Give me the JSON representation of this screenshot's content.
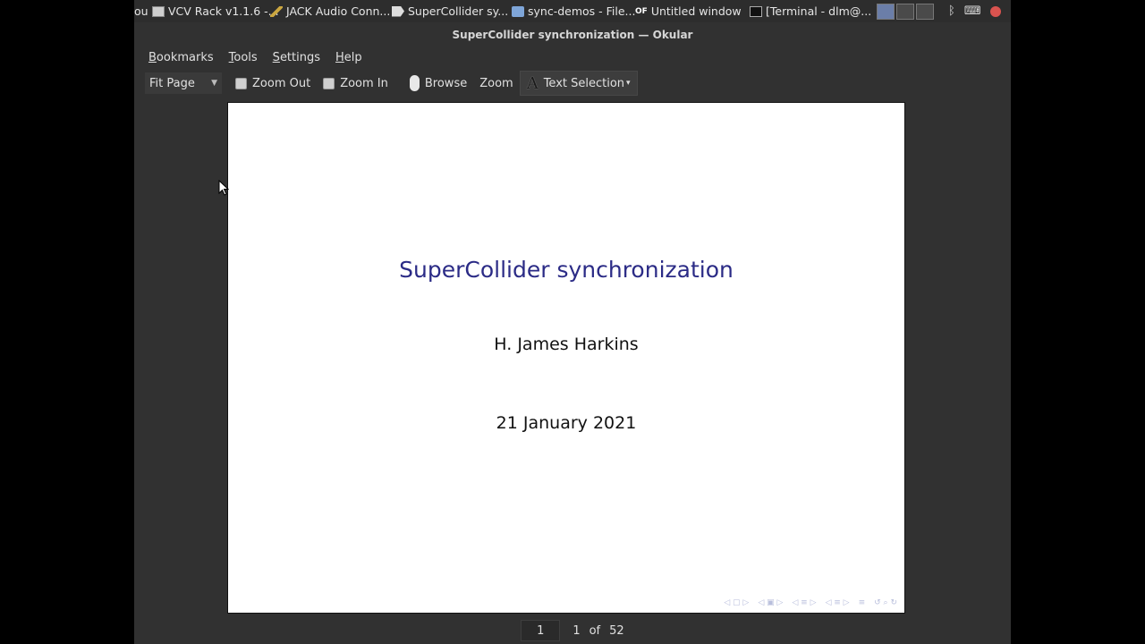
{
  "taskbar": {
    "tasks": [
      {
        "label": "ou",
        "icon": "none"
      },
      {
        "label": "VCV Rack v1.1.6 -...",
        "icon": "window-icon"
      },
      {
        "label": "JACK Audio Conn...",
        "icon": "jack-icon"
      },
      {
        "label": "SuperCollider sy...",
        "icon": "okular-icon"
      },
      {
        "label": "sync-demos - File...",
        "icon": "folder-icon"
      },
      {
        "label": "Untitled window",
        "icon": "of-icon",
        "badge": "OF"
      },
      {
        "label": "[Terminal - dlm@...",
        "icon": "terminal-icon"
      }
    ],
    "tray": {
      "bluetooth": "ᛒ",
      "keyboard": "⌨"
    }
  },
  "window": {
    "title": "SuperCollider synchronization — Okular"
  },
  "menubar": {
    "items": [
      "Bookmarks",
      "Tools",
      "Settings",
      "Help"
    ]
  },
  "toolbar": {
    "zoom_combo": "Fit Page",
    "zoom_out": "Zoom Out",
    "zoom_in": "Zoom In",
    "browse": "Browse",
    "zoom": "Zoom",
    "text_selection": "Text Selection"
  },
  "slide": {
    "title": "SuperCollider synchronization",
    "author": "H. James Harkins",
    "date": "21 January 2021",
    "nav_symbols": [
      "◁ ▢ ▷",
      "◁ ▣ ▷",
      "◁ ≡ ▷",
      "◁ ≡ ▷",
      "≡",
      "↺ ⌕ ↻"
    ]
  },
  "statusbar": {
    "page_input": "1",
    "current": "1",
    "of_label": "of",
    "total": "52"
  },
  "colors": {
    "title_blue": "#2b2b86",
    "window_bg": "#313131",
    "record": "#d9534f"
  }
}
